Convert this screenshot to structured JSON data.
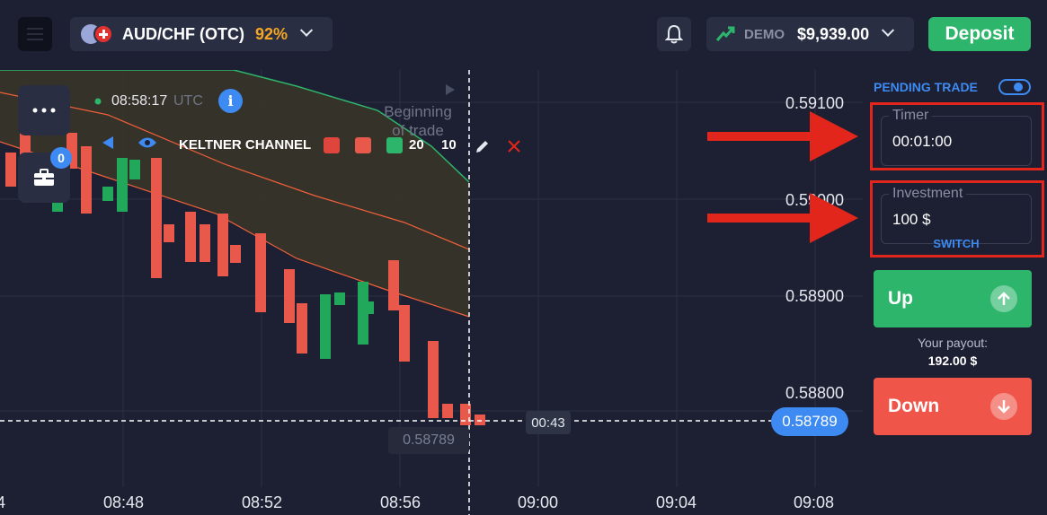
{
  "topbar": {
    "asset_name": "AUD/CHF (OTC)",
    "asset_payout": "92%",
    "account_type": "DEMO",
    "balance": "$9,939.00",
    "deposit_label": "Deposit"
  },
  "chart": {
    "server_time": "08:58:17",
    "timezone": "UTC",
    "info_glyph": "i",
    "trades_count": "0",
    "begin_line1": "Beginning",
    "begin_line2": "of trade",
    "indicator": {
      "name": "KELTNER CHANNEL",
      "period": "20",
      "multiplier": "10"
    },
    "y_ticks": [
      "0.59100",
      "0.59000",
      "0.58900",
      "0.58800"
    ],
    "x_ticks": [
      "4",
      "08:48",
      "08:52",
      "08:56",
      "09:00",
      "09:04",
      "09:08"
    ],
    "current_price": "0.58789",
    "ghost_price": "0.58789",
    "countdown": "00:43",
    "colors": {
      "bull": "#22a85a",
      "bear": "#e8594c",
      "band_fill": "#3a3628",
      "upper_line": "#2db56b",
      "mid_line": "#f0603a",
      "accent": "#3d8bf2"
    }
  },
  "trade_panel": {
    "pending_label": "PENDING TRADE",
    "timer_label": "Timer",
    "timer_value": "00:01:00",
    "investment_label": "Investment",
    "investment_value": "100 $",
    "switch_label": "SWITCH",
    "up_label": "Up",
    "down_label": "Down",
    "payout_label": "Your payout:",
    "payout_value": "192.00 $"
  },
  "icons": {
    "menu": "hamburger-icon",
    "bell": "bell-icon",
    "account": "arrow-trend-icon",
    "more": "more-dots-icon",
    "portfolio": "briefcase-icon",
    "info": "info-icon",
    "edit": "pencil-icon",
    "delete": "close-icon",
    "visibility": "eye-icon",
    "collapse": "triangle-left-icon"
  }
}
